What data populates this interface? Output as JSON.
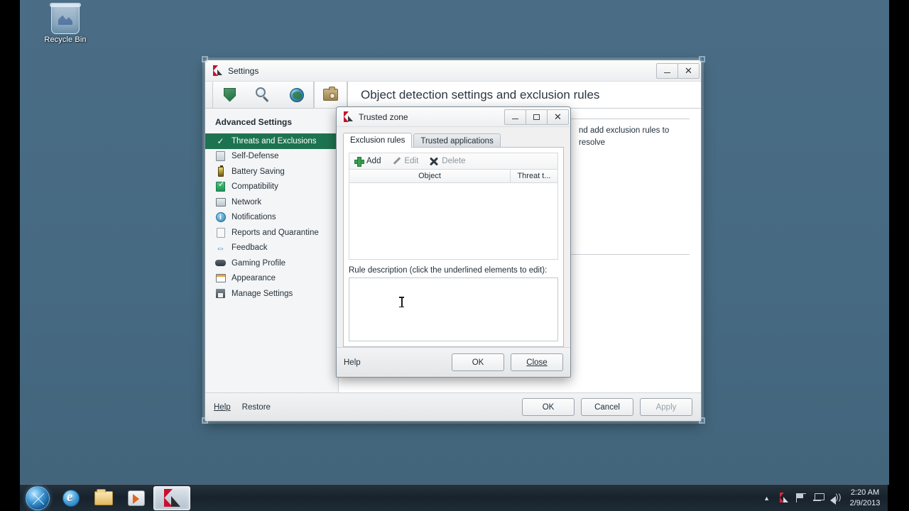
{
  "desktop": {
    "recycle_bin_label": "Recycle Bin",
    "background_color": "#476a82"
  },
  "settings_window": {
    "title": "Settings",
    "icon": "kaspersky-logo-icon",
    "controls": {
      "minimize": "minimize-icon",
      "close": "close-icon"
    },
    "toolbar_icons": [
      "shield-icon",
      "magnifier-icon",
      "globe-icon",
      "toolbox-icon"
    ],
    "selected_toolbar_icon": "toolbox-icon",
    "page_title": "Object detection settings and exclusion rules",
    "sidebar": {
      "heading": "Advanced Settings",
      "items": [
        {
          "label": "Threats and Exclusions",
          "icon": "check-icon",
          "active": true
        },
        {
          "label": "Self-Defense",
          "icon": "self-defense-icon",
          "active": false
        },
        {
          "label": "Battery Saving",
          "icon": "battery-icon",
          "active": false
        },
        {
          "label": "Compatibility",
          "icon": "compatibility-icon",
          "active": false
        },
        {
          "label": "Network",
          "icon": "network-icon",
          "active": false
        },
        {
          "label": "Notifications",
          "icon": "notification-icon",
          "active": false
        },
        {
          "label": "Reports and Quarantine",
          "icon": "reports-icon",
          "active": false
        },
        {
          "label": "Feedback",
          "icon": "feedback-icon",
          "active": false
        },
        {
          "label": "Gaming Profile",
          "icon": "gamepad-icon",
          "active": false
        },
        {
          "label": "Appearance",
          "icon": "appearance-icon",
          "active": false
        },
        {
          "label": "Manage Settings",
          "icon": "save-icon",
          "active": false
        }
      ]
    },
    "content": {
      "description_fragment": "nd add exclusion rules to resolve"
    },
    "footer": {
      "help_label": "Help",
      "restore_label": "Restore",
      "ok_label": "OK",
      "cancel_label": "Cancel",
      "apply_label": "Apply",
      "apply_disabled": true
    }
  },
  "trusted_zone_dialog": {
    "title": "Trusted zone",
    "icon": "kaspersky-logo-icon",
    "controls": {
      "minimize": "minimize-icon",
      "maximize": "maximize-icon",
      "close": "close-icon"
    },
    "tabs": [
      {
        "label": "Exclusion rules",
        "active": true
      },
      {
        "label": "Trusted applications",
        "active": false
      }
    ],
    "rule_toolbar": [
      {
        "label": "Add",
        "icon": "plus-icon",
        "enabled": true
      },
      {
        "label": "Edit",
        "icon": "pencil-icon",
        "enabled": false
      },
      {
        "label": "Delete",
        "icon": "x-icon",
        "enabled": false
      }
    ],
    "rule_table": {
      "columns": [
        "Object",
        "Threat t..."
      ],
      "rows": []
    },
    "rule_description_label": "Rule description (click the underlined elements to edit):",
    "rule_description_value": "",
    "footer": {
      "help_label": "Help",
      "ok_label": "OK",
      "close_label": "Close"
    }
  },
  "taskbar": {
    "start_label": "start-orb-icon",
    "items": [
      {
        "name": "internet-explorer",
        "icon": "ie-icon",
        "active": false
      },
      {
        "name": "windows-explorer",
        "icon": "folder-icon",
        "active": false
      },
      {
        "name": "windows-media-player",
        "icon": "media-player-icon",
        "active": false
      },
      {
        "name": "kaspersky",
        "icon": "kaspersky-logo-icon",
        "active": true
      }
    ],
    "tray": {
      "overflow": "show-hidden-icons-arrow",
      "icons": [
        "kaspersky-tray-icon",
        "action-center-flag-icon",
        "network-icon",
        "volume-icon"
      ],
      "time": "2:20 AM",
      "date": "2/9/2013"
    }
  }
}
